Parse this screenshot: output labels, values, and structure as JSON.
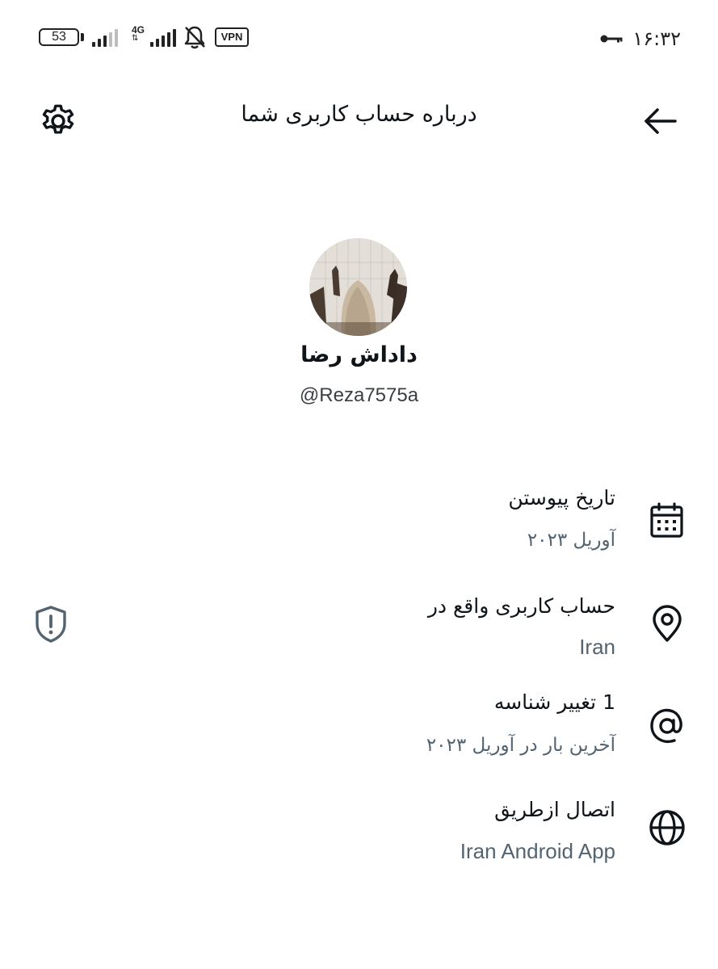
{
  "status_bar": {
    "battery": "53",
    "network": "4G",
    "vpn": "VPN",
    "time": "۱۶:۳۲"
  },
  "header": {
    "title": "درباره حساب کاربری شما",
    "back_icon": "arrow-left-icon",
    "settings_icon": "gear-icon"
  },
  "profile": {
    "name": "داداش رضا",
    "handle": "@Reza7575a"
  },
  "details": [
    {
      "icon": "calendar-icon",
      "title": "تاریخ پیوستن",
      "value": "آوریل ۲۰۲۳"
    },
    {
      "icon": "location-pin-icon",
      "title": "حساب کاربری واقع در",
      "value": "Iran"
    },
    {
      "icon": "at-sign-icon",
      "title": "1 تغییر شناسه",
      "value": "آخرین بار در آوریل ۲۰۲۳"
    },
    {
      "icon": "globe-icon",
      "title": "اتصال ازطریق",
      "value": "Iran Android App"
    }
  ],
  "colors": {
    "primary_text": "#0f1419",
    "secondary_text": "#536471",
    "shield_icon": "#536471"
  }
}
